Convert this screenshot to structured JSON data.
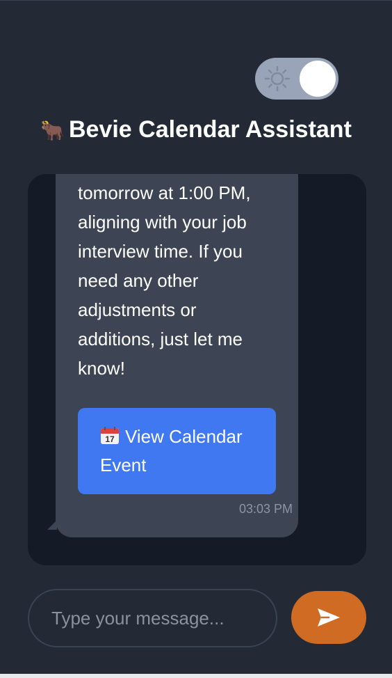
{
  "theme_toggle": {
    "icon": "sun-icon",
    "state": "dark"
  },
  "header": {
    "logo_emoji": "🐂",
    "title": "Bevie Calendar Assistant"
  },
  "chat": {
    "message": {
      "text": "tomorrow at 1:00 PM,\naligning with your job\ninterview time. If you\nneed any other\nadjustments or\nadditions, just let me\nknow!",
      "action_button": {
        "icon": "calendar-icon",
        "label": "View Calendar\nEvent"
      },
      "timestamp": "03:03 PM"
    }
  },
  "composer": {
    "placeholder": "Type your message...",
    "value": "",
    "send_icon": "send-icon"
  },
  "colors": {
    "background": "#232a36",
    "chat_background": "#151b26",
    "bubble": "#3d4453",
    "accent_blue": "#3f78f0",
    "send_orange": "#cf6b22",
    "toggle_track": "#9aa4b8"
  }
}
